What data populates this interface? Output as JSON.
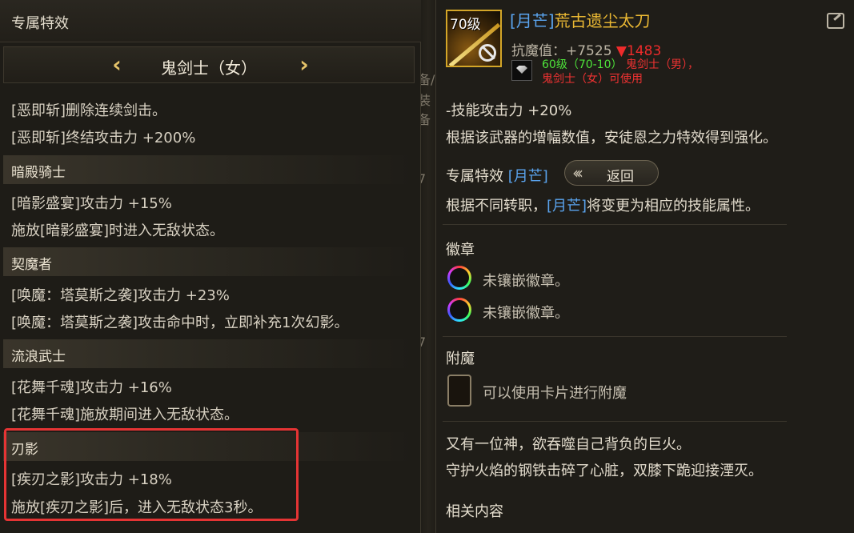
{
  "background": {
    "glyph_a": "备/",
    "glyph_b": "装备",
    "glyph_c": "7",
    "glyph_d": "7"
  },
  "left_panel": {
    "title": "专属特效",
    "job_selector": {
      "prev": "‹",
      "name": "鬼剑士（女）",
      "next": "›"
    },
    "intro_lines": [
      "[恶即斩]删除连续剑击。",
      "[恶即斩]终结攻击力 +200%"
    ],
    "jobs": [
      {
        "name": "暗殿骑士",
        "lines": [
          "[暗影盛宴]攻击力 +15%",
          "施放[暗影盛宴]时进入无敌状态。"
        ]
      },
      {
        "name": "契魔者",
        "lines": [
          "[唤魔：塔莫斯之袭]攻击力 +23%",
          "[唤魔：塔莫斯之袭]攻击命中时，立即补充1次幻影。"
        ]
      },
      {
        "name": "流浪武士",
        "lines": [
          "[花舞千魂]攻击力 +16%",
          "[花舞千魂]施放期间进入无敌状态。"
        ]
      },
      {
        "name": "刃影",
        "lines": [
          "[疾刃之影]攻击力 +18%",
          "施放[疾刃之影]后，进入无敌状态3秒。"
        ]
      }
    ]
  },
  "right_panel": {
    "item": {
      "level": "70级",
      "tag": "[月芒]",
      "name": "荒古遗尘太刀",
      "anti_magic_label": "抗魔值：+7525",
      "anti_magic_change": "▼1483",
      "req_line1_green": "60级（70-10）",
      "req_line1_red": "鬼剑士（男），",
      "req_line2_red": "鬼剑士（女）可使用"
    },
    "effect_lines": [
      "-技能攻击力 +20%",
      "根据该武器的增幅数值，安徒恩之力特效得到强化。"
    ],
    "exclusive": {
      "label": "专属特效",
      "tag": "[月芒]",
      "back_label": "返回",
      "desc_before": "根据不同转职，",
      "desc_tag": "[月芒]",
      "desc_after": "将变更为相应的技能属性。"
    },
    "emblem": {
      "title": "徽章",
      "slots": [
        "未镶嵌徽章。",
        "未镶嵌徽章。"
      ]
    },
    "enchant": {
      "title": "附魔",
      "text": "可以使用卡片进行附魔"
    },
    "lore": [
      "又有一位神，欲吞噬自己背负的巨火。",
      "守护火焰的钢铁击碎了心脏，双膝下跪迎接湮灭。"
    ],
    "related": "相关内容"
  },
  "colors": {
    "gold": "#eab833",
    "blue_tag": "#5aa4ee",
    "red": "#ee2b2b",
    "green": "#4ee33a",
    "highlight": "#e53434"
  }
}
